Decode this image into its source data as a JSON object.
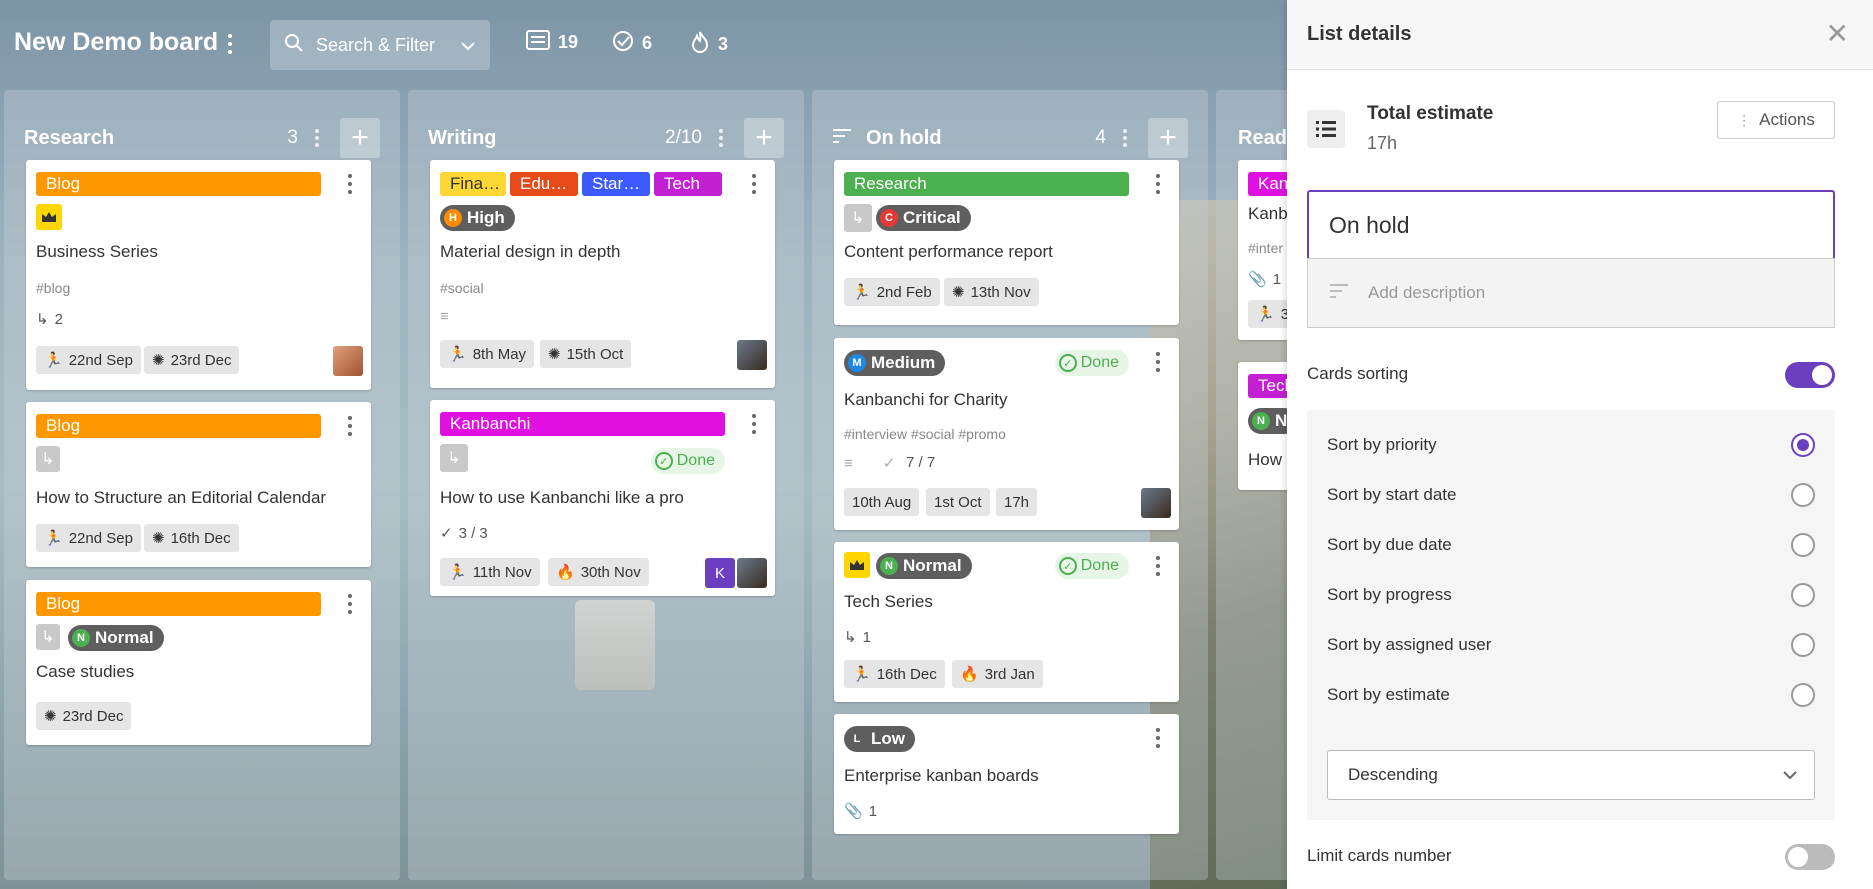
{
  "board": {
    "title": "New Demo board",
    "search_label": "Search & Filter",
    "stats": {
      "cards": "19",
      "done": "6",
      "burning": "3"
    }
  },
  "columns": [
    {
      "title": "Research",
      "count": "3",
      "cards": [
        {
          "tag": "Blog",
          "title": "Business Series",
          "hashtags": "#blog",
          "subcards": "2",
          "start": "22nd Sep",
          "due": "23rd Dec"
        },
        {
          "tag": "Blog",
          "title": "How to Structure an Editorial Calendar",
          "start": "22nd Sep",
          "due": "16th Dec"
        },
        {
          "tag": "Blog",
          "priority": "Normal",
          "priority_letter": "N",
          "title": "Case studies",
          "due": "23rd Dec"
        }
      ]
    },
    {
      "title": "Writing",
      "count": "2/10",
      "cards": [
        {
          "tags": [
            "Fina…",
            "Edu…",
            "Star…",
            "Tech"
          ],
          "priority": "High",
          "priority_letter": "H",
          "title": "Material design in depth",
          "hashtags": "#social",
          "start": "8th May",
          "due": "15th Oct"
        },
        {
          "tag": "Kanbanchi",
          "done": "Done",
          "title": "How to use Kanbanchi like a pro",
          "checklist": "3 / 3",
          "start": "11th Nov",
          "due": "30th Nov",
          "avatar_letter": "K"
        }
      ]
    },
    {
      "title": "On hold",
      "count": "4",
      "cards": [
        {
          "tag": "Research",
          "priority": "Critical",
          "priority_letter": "C",
          "title": "Content performance report",
          "start": "2nd Feb",
          "due": "13th Nov"
        },
        {
          "priority": "Medium",
          "priority_letter": "M",
          "done": "Done",
          "title": "Kanbanchi for Charity",
          "hashtags": "#interview  #social  #promo",
          "checklist": "7 / 7",
          "start": "10th Aug",
          "due": "1st Oct",
          "estimate": "17h"
        },
        {
          "priority": "Normal",
          "priority_letter": "N",
          "done": "Done",
          "title": "Tech Series",
          "subcards": "1",
          "start": "16th Dec",
          "due": "3rd Jan"
        },
        {
          "priority": "Low",
          "priority_letter": "L",
          "title": "Enterprise kanban boards",
          "attachments": "1"
        }
      ]
    },
    {
      "title": "Ready",
      "cards": [
        {
          "tag": "Kan",
          "title": "Kanb",
          "hashtags": "#inter",
          "attachments": "1",
          "start": "3"
        },
        {
          "tag": "Tech",
          "priority_letter": "N",
          "priority": "N",
          "title": "How"
        }
      ]
    }
  ],
  "panel": {
    "title": "List details",
    "estimate_label": "Total estimate",
    "estimate_value": "17h",
    "actions_label": "Actions",
    "list_name": "On hold",
    "description_placeholder": "Add description",
    "sorting_label": "Cards sorting",
    "sorting_enabled": true,
    "sort_options": [
      "Sort by priority",
      "Sort by start date",
      "Sort by due date",
      "Sort by progress",
      "Sort by assigned user",
      "Sort by estimate"
    ],
    "selected_sort": "Sort by priority",
    "order_value": "Descending",
    "limit_label": "Limit cards number",
    "limit_enabled": false
  },
  "colors": {
    "accent": "#6c3fc0",
    "blog": "#ff9800",
    "finance": "#fdd835",
    "education": "#e64a19",
    "startup": "#3d5afe",
    "tech": "#c51fd3",
    "kanbanchi": "#e010e0",
    "research": "#4caf50",
    "done": "#4caf50"
  }
}
